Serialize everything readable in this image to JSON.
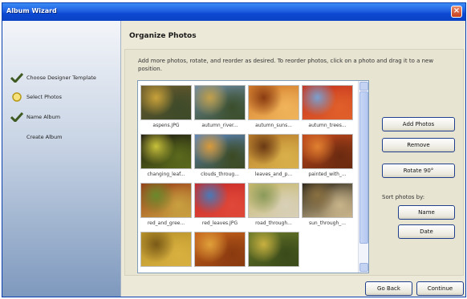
{
  "window": {
    "title": "Album Wizard",
    "close_label": "×"
  },
  "sidebar": {
    "steps": [
      {
        "label": "Choose Designer Template",
        "icon": "checkmark-icon",
        "status": "complete"
      },
      {
        "label": "Select Photos",
        "icon": "current-step-icon",
        "status": "current"
      },
      {
        "label": "Name Album",
        "icon": "checkmark-icon",
        "status": "complete"
      },
      {
        "label": "Create Album",
        "icon": "",
        "status": "pending"
      }
    ]
  },
  "page": {
    "title": "Organize Photos",
    "instructions": "Add more photos, rotate, and reorder as desired. To reorder photos, click on a photo and drag it to a new position."
  },
  "photos": [
    {
      "caption": "aspens.JPG",
      "colors": [
        "#6b5a2c",
        "#c8a23a",
        "#3d4a2a"
      ]
    },
    {
      "caption": "autumn_river...",
      "colors": [
        "#6e8ba6",
        "#c2a04a",
        "#3b4f2c"
      ]
    },
    {
      "caption": "autumn_suns...",
      "colors": [
        "#d27a2a",
        "#8a3c12",
        "#f0b45a"
      ]
    },
    {
      "caption": "autumn_trees...",
      "colors": [
        "#c6321e",
        "#7aa0d0",
        "#e0602a"
      ]
    },
    {
      "caption": "changing_leaf...",
      "colors": [
        "#1c1a12",
        "#c8c23a",
        "#5a6a1c"
      ]
    },
    {
      "caption": "clouds_throug...",
      "colors": [
        "#5a86c0",
        "#d89a3a",
        "#3c4a22"
      ]
    },
    {
      "caption": "leaves_and_p...",
      "colors": [
        "#b87a2a",
        "#6a3a14",
        "#d8b04a"
      ]
    },
    {
      "caption": "painted_with_...",
      "colors": [
        "#c2481c",
        "#e08030",
        "#6a2a10"
      ]
    },
    {
      "caption": "red_and_gree...",
      "colors": [
        "#9a3c18",
        "#6a8a2c",
        "#c8a040"
      ]
    },
    {
      "caption": "red_leaves.JPG",
      "colors": [
        "#c82a28",
        "#4a7ab8",
        "#e04838"
      ]
    },
    {
      "caption": "road_through...",
      "colors": [
        "#c8b86a",
        "#8a9a5a",
        "#d8d0b8"
      ]
    },
    {
      "caption": "sun_through_...",
      "colors": [
        "#2a2418",
        "#8a7040",
        "#c8b48a"
      ]
    },
    {
      "caption": "",
      "colors": [
        "#b8922a",
        "#7a5a18",
        "#d8b040"
      ]
    },
    {
      "caption": "",
      "colors": [
        "#c8641c",
        "#e0a03a",
        "#8a3a10"
      ]
    },
    {
      "caption": "",
      "colors": [
        "#6a7a2a",
        "#c8b040",
        "#3a4a1a"
      ]
    }
  ],
  "actions": {
    "add_photos": "Add Photos",
    "remove": "Remove",
    "rotate": "Rotate 90°",
    "sort_label": "Sort photos by:",
    "sort_name": "Name",
    "sort_date": "Date"
  },
  "footer": {
    "back": "Go Back",
    "continue": "Continue"
  }
}
